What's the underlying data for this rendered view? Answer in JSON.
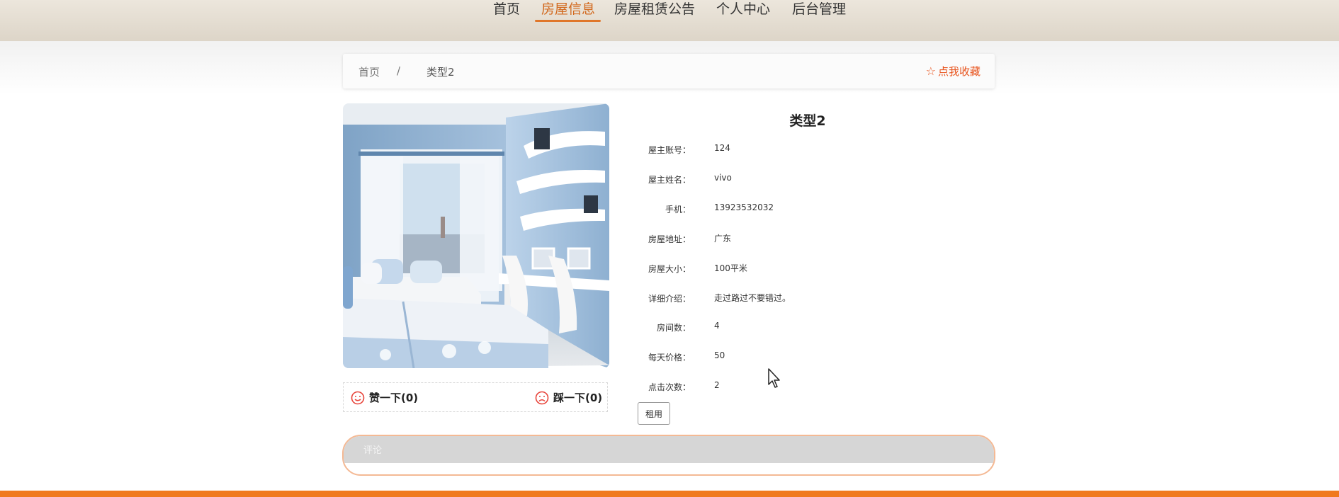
{
  "nav": {
    "items": [
      {
        "label": "首页",
        "active": false
      },
      {
        "label": "房屋信息",
        "active": true
      },
      {
        "label": "房屋租赁公告",
        "active": false
      },
      {
        "label": "个人中心",
        "active": false
      },
      {
        "label": "后台管理",
        "active": false
      }
    ]
  },
  "breadcrumb": {
    "home": "首页",
    "separator": "/",
    "current": "类型2"
  },
  "favorite": {
    "label": "点我收藏",
    "icon": "star-outline-icon"
  },
  "house": {
    "title": "类型2",
    "fields": [
      {
        "label": "屋主账号：",
        "value": "124"
      },
      {
        "label": "屋主姓名：",
        "value": "vivo"
      },
      {
        "label": "手机：",
        "value": "13923532032"
      },
      {
        "label": "房屋地址：",
        "value": "广东"
      },
      {
        "label": "房屋大小：",
        "value": "100平米"
      },
      {
        "label": "详细介绍：",
        "value": "走过路过不要错过。"
      },
      {
        "label": "房间数：",
        "value": "4"
      },
      {
        "label": "每天价格：",
        "value": "50"
      },
      {
        "label": "点击次数：",
        "value": "2"
      }
    ],
    "rent_button": "租用"
  },
  "votes": {
    "like_label": "赞一下(0)",
    "dislike_label": "踩一下(0)",
    "like_icon": "smile-icon",
    "dislike_icon": "frown-icon"
  },
  "comments": {
    "label": "评论"
  },
  "colors": {
    "accent": "#e0772b",
    "favorite": "#e8551f",
    "bottom_strip": "#f07a1e"
  }
}
